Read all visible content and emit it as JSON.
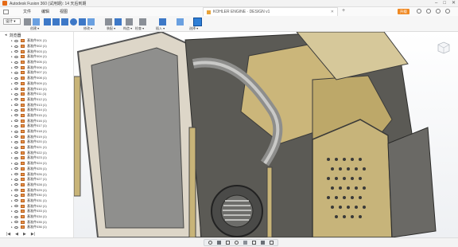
{
  "window": {
    "title": "Autodesk Fusion 360 (试用期): 14 天后到期",
    "controls": [
      "–",
      "□",
      "✕"
    ]
  },
  "menu": {
    "items": [
      "文件",
      "编辑",
      "视图"
    ]
  },
  "document_tab": {
    "label": "KOHLER ENGINE · DESIGN v1",
    "close": "✕"
  },
  "promo_button": {
    "label": "升级"
  },
  "ribbon": {
    "workspace": "设计 ▾",
    "tools": [
      {
        "label": "创建 ▾"
      },
      {
        "label": "修改 ▾"
      },
      {
        "label": "装配 ▾"
      },
      {
        "label": "构造 ▾"
      },
      {
        "label": "检查 ▾"
      },
      {
        "label": "插入 ▾"
      },
      {
        "label": "选择 ▾"
      }
    ]
  },
  "browser": {
    "title": "浏览器",
    "items": [
      "基准件001 (1)",
      "基准件002 (1)",
      "基准件003 (1)",
      "基准件004 (1)",
      "基准件005 (1)",
      "基准件006 (1)",
      "基准件007 (1)",
      "基准件008 (1)",
      "基准件009 (1)",
      "基准件010 (1)",
      "基准件011 (1)",
      "基准件012 (1)",
      "基准件013 (1)",
      "基准件014 (1)",
      "基准件015 (1)",
      "基准件016 (1)",
      "基准件017 (1)",
      "基准件018 (1)",
      "基准件019 (1)",
      "基准件020 (1)",
      "基准件021 (1)",
      "基准件022 (1)",
      "基准件023 (1)",
      "基准件024 (1)",
      "基准件025 (1)",
      "基准件026 (1)",
      "基准件027 (1)",
      "基准件028 (1)",
      "基准件029 (1)",
      "基准件030 (1)",
      "基准件031 (1)",
      "基准件032 (1)",
      "基准件033 (1)",
      "基准件034 (1)",
      "基准件035 (1)",
      "基准件036 (1)"
    ],
    "footer": [
      "|◀",
      "◀",
      "▶",
      "▶|"
    ]
  },
  "colors": {
    "accent": "#e56a16",
    "component": "#e7924a",
    "tool_blue": "#3d78c7",
    "engine_tan": "#cbb67a",
    "engine_dark": "#3b3b3a"
  }
}
